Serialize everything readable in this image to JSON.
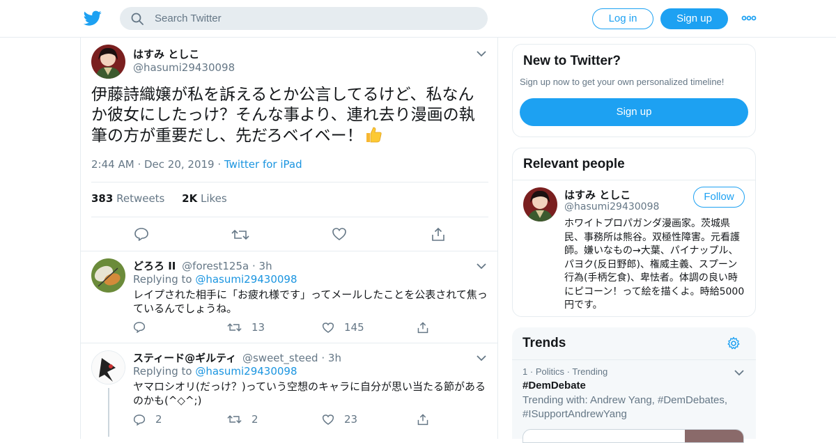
{
  "header": {
    "search_placeholder": "Search Twitter",
    "login_label": "Log in",
    "signup_label": "Sign up"
  },
  "tweet": {
    "author_name": "はすみ としこ",
    "author_handle": "@hasumi29430098",
    "text": "伊藤詩織嬢が私を訴えるとか公言してるけど、私なんか彼女にしたっけ？そんな事より、連れ去り漫画の執筆の方が重要だし、先だろベイベー！",
    "time": "2:44 AM",
    "date": "Dec 20, 2019",
    "source": "Twitter for iPad",
    "retweets_count": "383",
    "retweets_label": "Retweets",
    "likes_count": "2K",
    "likes_label": "Likes"
  },
  "replies": [
    {
      "name": "どろろ II",
      "handle": "@forest125a",
      "time": "3h",
      "replying_label": "Replying to",
      "replying_to": "@hasumi29430098",
      "text": "レイプされた相手に「お疲れ様です」ってメールしたことを公表されて焦っているんでしょうね。",
      "reply_count": "",
      "retweet_count": "13",
      "like_count": "145"
    },
    {
      "name": "スティード@ギルティ",
      "handle": "@sweet_steed",
      "time": "3h",
      "replying_label": "Replying to",
      "replying_to": "@hasumi29430098",
      "text": "ヤマロシオリ(だっけ？)っていう空想のキャラに自分が思い当たる節があるのかも(^◇^;)",
      "reply_count": "2",
      "retweet_count": "2",
      "like_count": "23"
    }
  ],
  "sidebar": {
    "new_title": "New to Twitter?",
    "new_subtitle": "Sign up now to get your own personalized timeline!",
    "new_signup_label": "Sign up",
    "relevant_title": "Relevant people",
    "person_name": "はすみ としこ",
    "person_handle": "@hasumi29430098",
    "follow_label": "Follow",
    "person_bio": "ホワイトプロパガンダ漫画家。茨城県民、事務所は熊谷。双極性障害。元看護師。嫌いなもの→大葉、パイナップル、パヨク(反日野郎)、権威主義、スプーン行為(手柄乞食)、卑怯者。体調の良い時にピコーン！って絵を描くよ。時給5000円です。",
    "trends_title": "Trends",
    "trend_rank": "1",
    "trend_category": "Politics",
    "trend_status": "Trending",
    "trend_name": "#DemDebate",
    "trend_with": "Trending with: Andrew Yang, #DemDebates, #ISupportAndrewYang"
  },
  "colors": {
    "brand": "#1da1f2",
    "link": "#1b95e0",
    "muted": "#657786",
    "border": "#e6ecf0"
  }
}
